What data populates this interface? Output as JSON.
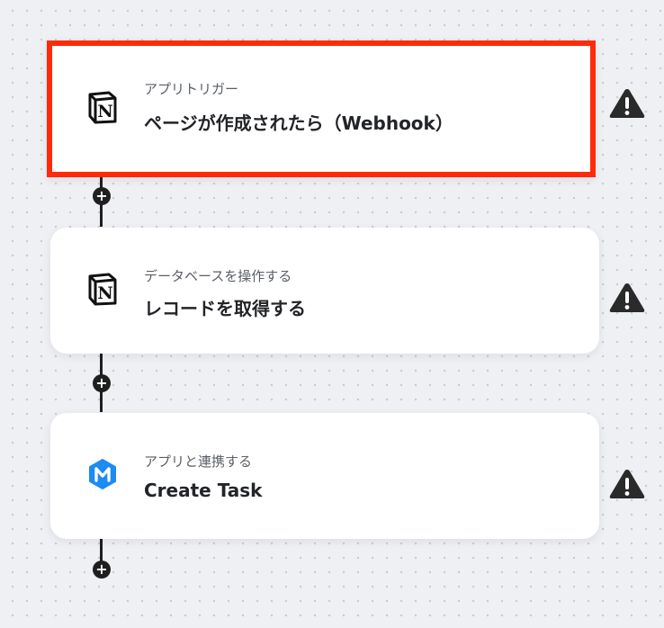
{
  "steps": [
    {
      "subtitle": "アプリトリガー",
      "title": "ページが作成されたら（Webhook）",
      "app_icon": "notion-icon",
      "selected": true,
      "warning_icon": "warning-icon"
    },
    {
      "subtitle": "データベースを操作する",
      "title": "レコードを取得する",
      "app_icon": "notion-icon",
      "selected": false,
      "warning_icon": "warning-icon"
    },
    {
      "subtitle": "アプリと連携する",
      "title": "Create Task",
      "app_icon": "meistertask-icon",
      "selected": false,
      "warning_icon": "warning-icon"
    }
  ],
  "add_button_symbol": "+",
  "colors": {
    "highlight": "#ff2a0a",
    "connector": "#1f1f1f",
    "meistertask": "#1c8bf2",
    "background": "#eef0f3"
  }
}
